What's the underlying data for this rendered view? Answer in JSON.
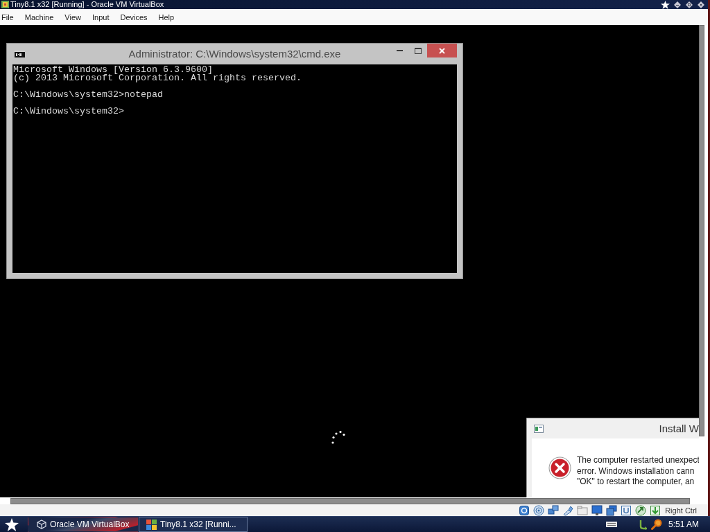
{
  "window": {
    "title": "Tiny8.1 x32 [Running] - Oracle VM VirtualBox"
  },
  "menu_bar": [
    "File",
    "Machine",
    "View",
    "Input",
    "Devices",
    "Help"
  ],
  "guest_screen": {
    "console_window": {
      "title": "Administrator: C:\\Windows\\system32\\cmd.exe",
      "output_blocks": [
        [
          "Microsoft Windows [Version 6.3.9600]",
          "(c) 2013 Microsoft Corporation. All rights reserved."
        ],
        [
          "C:\\Windows\\system32>notepad"
        ],
        [
          "C:\\Windows\\system32>"
        ]
      ]
    },
    "dialog": {
      "title": "Install W",
      "message_lines": [
        "The computer restarted unexpect",
        "error. Windows installation cann",
        "\"OK\" to restart the computer, an"
      ]
    }
  },
  "status_bar": {
    "host_key": "Right Ctrl"
  },
  "taskbar": {
    "buttons": [
      {
        "label": "Oracle VM VirtualBox",
        "selected": false
      },
      {
        "label": "Tiny8.1 x32 [Runni...",
        "selected": true
      }
    ],
    "clock": "5:51 AM"
  }
}
